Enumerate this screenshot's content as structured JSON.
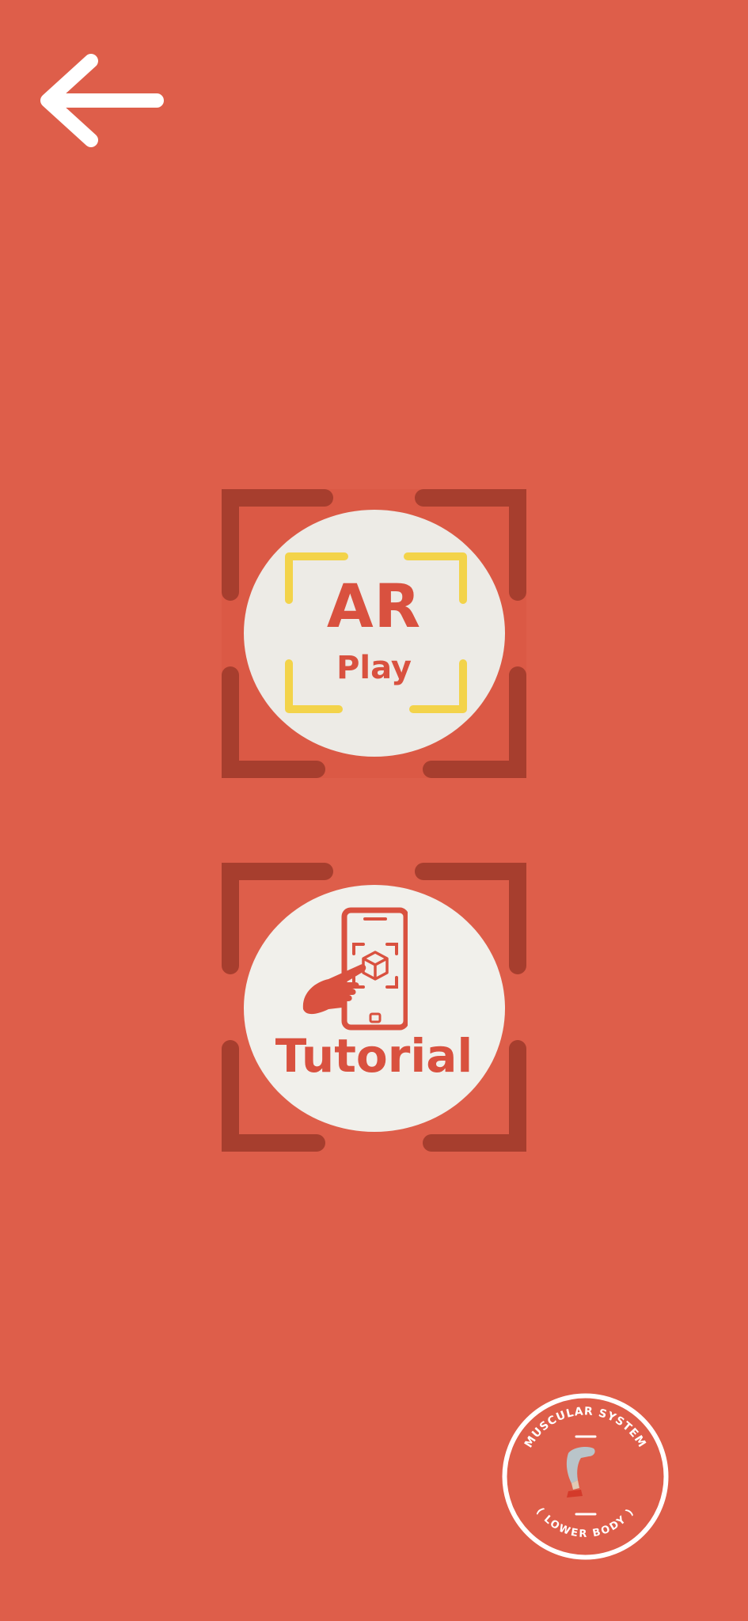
{
  "colors": {
    "background": "#DE5E4A",
    "frame": "#A73E2E",
    "disc": "#EDEBE6",
    "accent_text": "#D9513F",
    "ar_bracket": "#F3D34A",
    "white": "#FFFFFF"
  },
  "header": {
    "back_icon": "arrow-left-icon"
  },
  "menu": {
    "ar_play": {
      "title": "AR",
      "subtitle": "Play",
      "icon": "ar-scan-frame-icon"
    },
    "tutorial": {
      "label": "Tutorial",
      "icon": "tablet-touch-icon"
    }
  },
  "badge": {
    "top_text": "MUSCULAR SYSTEM",
    "bottom_text": "( LOWER BODY )",
    "icon": "leg-icon"
  }
}
